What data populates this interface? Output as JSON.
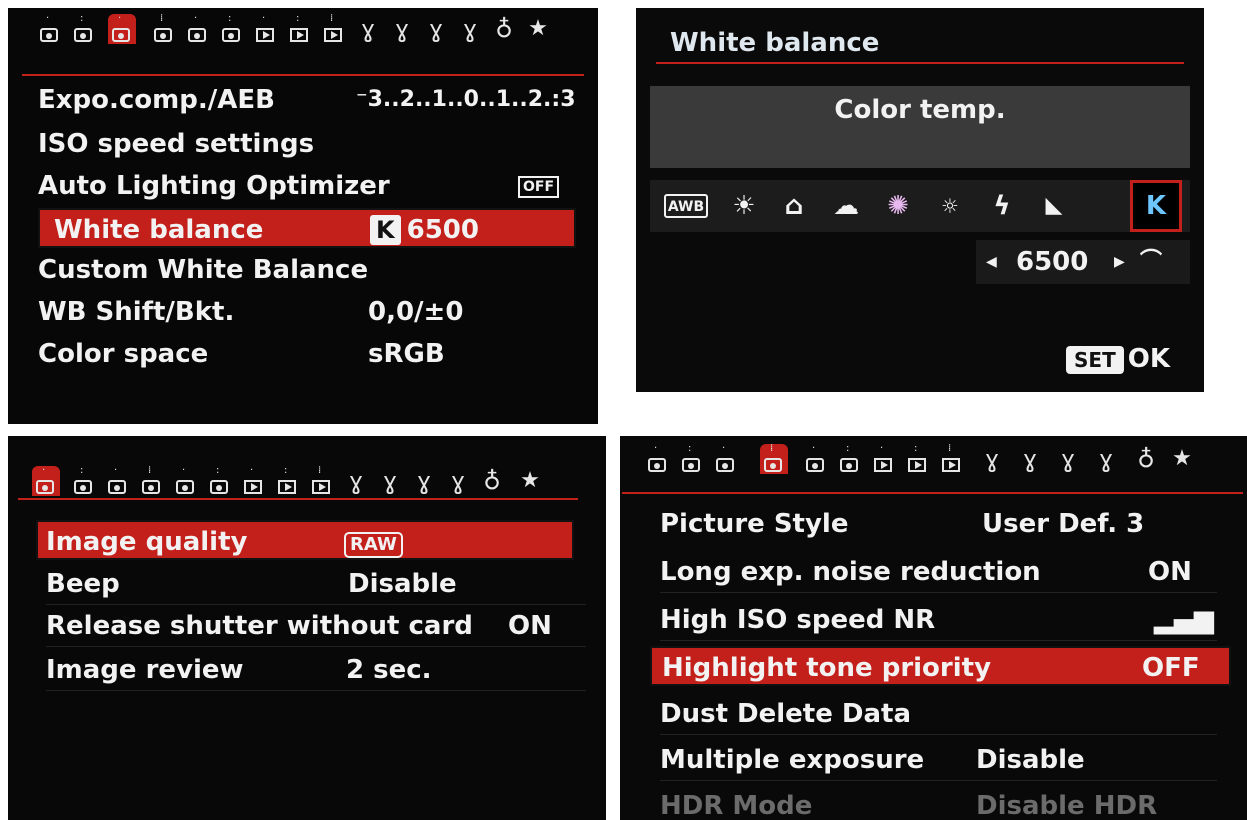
{
  "top_left": {
    "items": [
      {
        "label": "Expo.comp./AEB",
        "value": "⁻3..2..1..0..1..2.:3"
      },
      {
        "label": "ISO speed settings",
        "value": ""
      },
      {
        "label": "Auto Lighting Optimizer",
        "value": "OFF"
      },
      {
        "label": "White balance",
        "badge": "K",
        "value": "6500"
      },
      {
        "label": "Custom White Balance",
        "value": ""
      },
      {
        "label": "WB Shift/Bkt.",
        "value": "0,0/±0"
      },
      {
        "label": "Color space",
        "value": "sRGB"
      }
    ]
  },
  "top_right": {
    "title": "White balance",
    "mode_name": "Color temp.",
    "icons": [
      "AWB",
      "daylight-icon",
      "shade-icon",
      "cloudy-icon",
      "tungsten-icon",
      "fluorescent-icon",
      "flash-icon",
      "custom-icon",
      "K"
    ],
    "temp_value": "6500",
    "set_label": "SET",
    "ok_label": "OK"
  },
  "bottom_left": {
    "items": [
      {
        "label": "Image quality",
        "value": "RAW"
      },
      {
        "label": "Beep",
        "value": "Disable"
      },
      {
        "label": "Release shutter without card",
        "value": "ON"
      },
      {
        "label": "Image review",
        "value": "2 sec."
      }
    ]
  },
  "bottom_right": {
    "items": [
      {
        "label": "Picture Style",
        "value": "User Def. 3"
      },
      {
        "label": "Long exp. noise reduction",
        "value": "ON"
      },
      {
        "label": "High ISO speed NR",
        "value": ""
      },
      {
        "label": "Highlight tone priority",
        "value": "OFF"
      },
      {
        "label": "Dust Delete Data",
        "value": ""
      },
      {
        "label": "Multiple exposure",
        "value": "Disable"
      },
      {
        "label": "HDR Mode",
        "value": "Disable HDR"
      }
    ]
  },
  "colors": {
    "accent": "#c3201b",
    "background": "#0a0a0a",
    "text": "#f2f2f2"
  }
}
